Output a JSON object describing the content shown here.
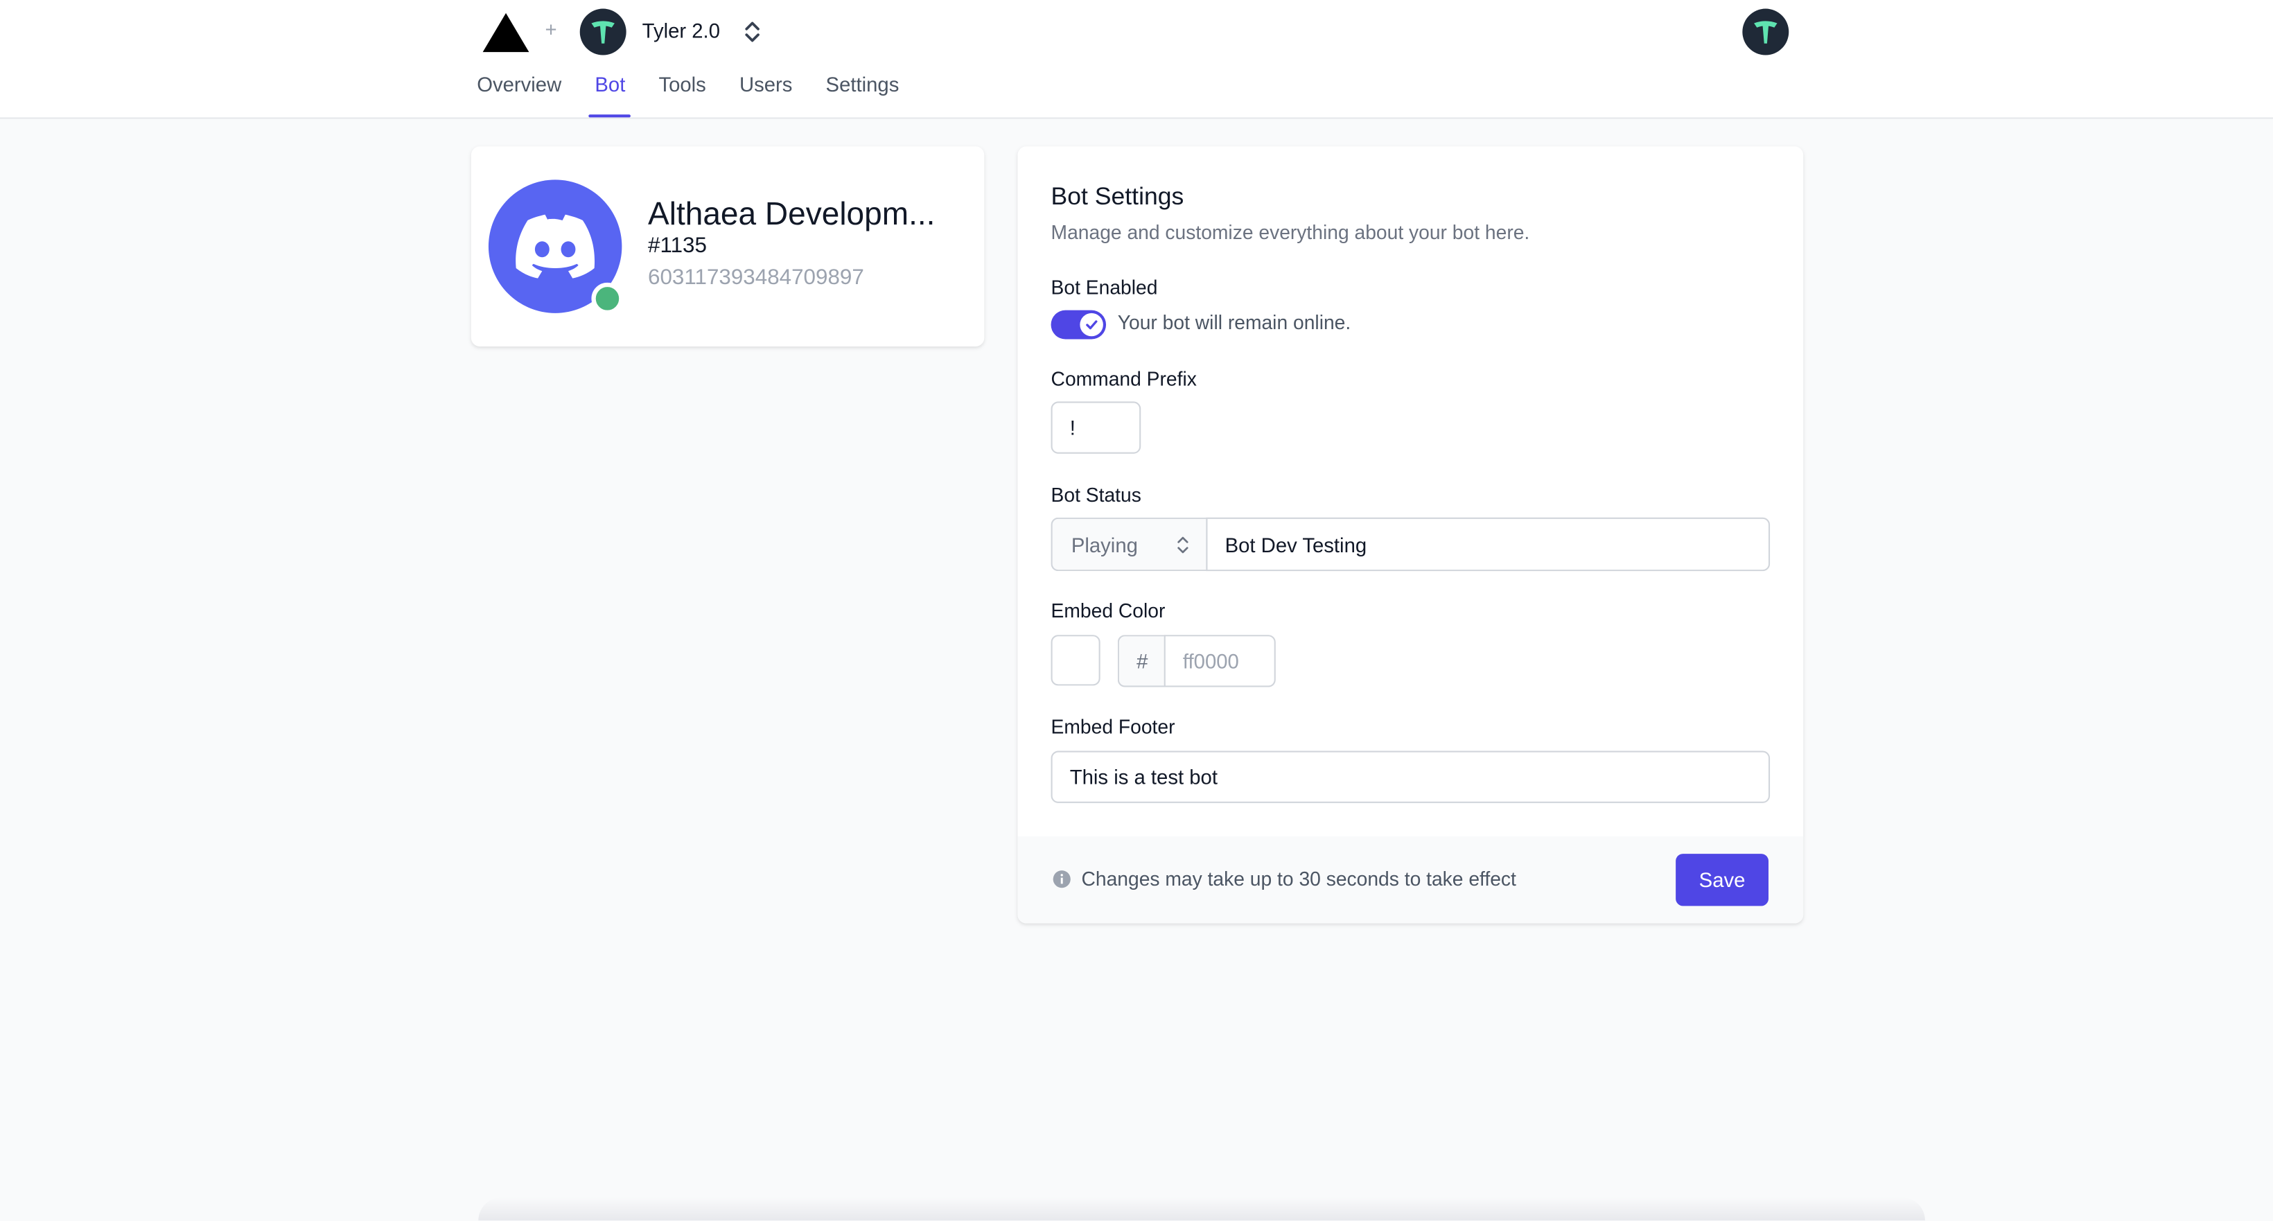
{
  "header": {
    "project_name": "Tyler 2.0",
    "plus": "+",
    "tabs": [
      {
        "label": "Overview",
        "active": false
      },
      {
        "label": "Bot",
        "active": true
      },
      {
        "label": "Tools",
        "active": false
      },
      {
        "label": "Users",
        "active": false
      },
      {
        "label": "Settings",
        "active": false
      }
    ]
  },
  "bot": {
    "name": "Althaea Developm...",
    "discriminator": "#1135",
    "id": "603117393484709897",
    "status": "online",
    "status_color": "#4bb57c",
    "avatar_color": "#5865f2"
  },
  "settings": {
    "title": "Bot Settings",
    "description": "Manage and customize everything about your bot here.",
    "enabled_label": "Bot Enabled",
    "enabled": true,
    "enabled_text": "Your bot will remain online.",
    "prefix_label": "Command Prefix",
    "prefix_value": "!",
    "status_label": "Bot Status",
    "status_type": "Playing",
    "status_text": "Bot Dev Testing",
    "embed_color_label": "Embed Color",
    "hash": "#",
    "embed_color_placeholder": "ff0000",
    "embed_footer_label": "Embed Footer",
    "embed_footer_value": "This is a test bot",
    "notice": "Changes may take up to 30 seconds to take effect",
    "save_label": "Save",
    "accent": "#4f46e5"
  }
}
